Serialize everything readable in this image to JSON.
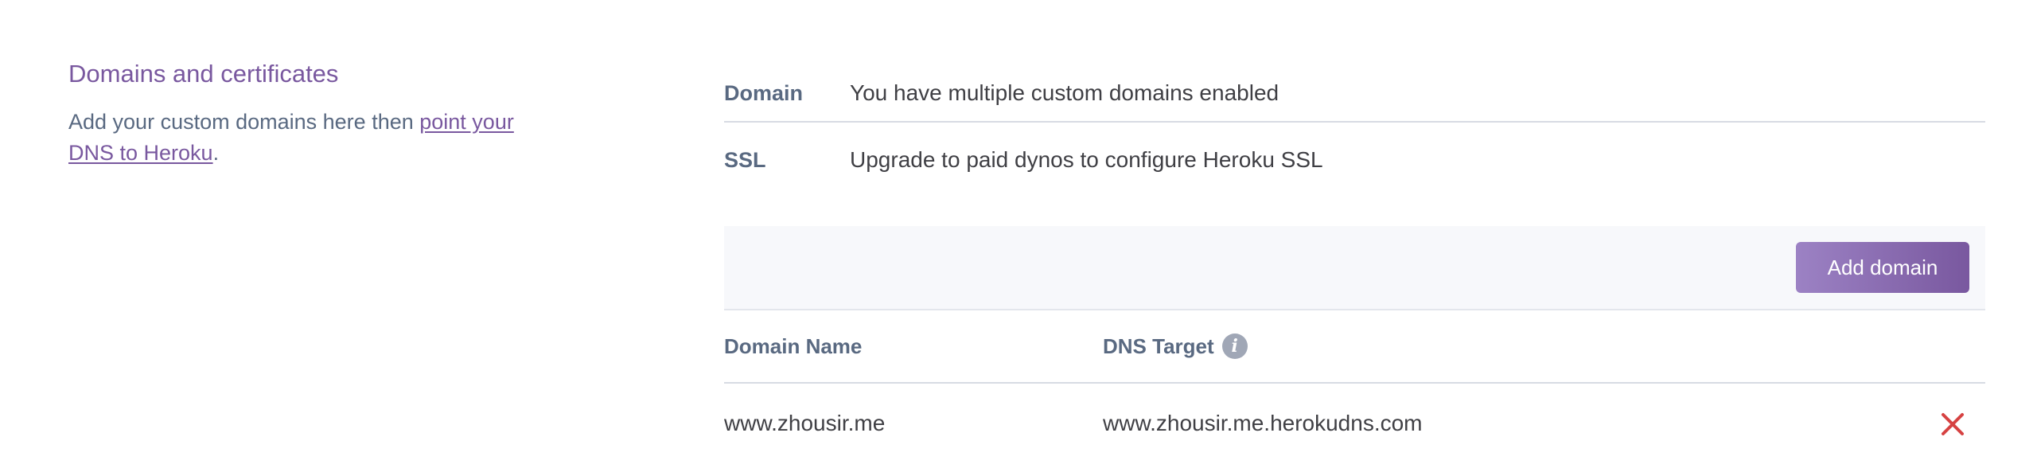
{
  "section": {
    "title": "Domains and certificates",
    "desc_prefix": "Add your custom domains here then ",
    "desc_link": "point your DNS to Heroku",
    "desc_suffix": "."
  },
  "info": {
    "domain_label": "Domain",
    "domain_value": "You have multiple custom domains enabled",
    "ssl_label": "SSL",
    "ssl_value": "Upgrade to paid dynos to configure Heroku SSL"
  },
  "toolbar": {
    "add_button": "Add domain"
  },
  "table": {
    "columns": [
      "Domain Name",
      "DNS Target"
    ],
    "info_icon": "i",
    "rows": [
      {
        "domain": "www.zhousir.me",
        "target": "www.zhousir.me.herokudns.com"
      }
    ]
  },
  "icons": {
    "info": "info-icon",
    "delete": "close-icon"
  },
  "colors": {
    "accent": "#79589f",
    "label": "#596981",
    "delete": "#d64242"
  }
}
